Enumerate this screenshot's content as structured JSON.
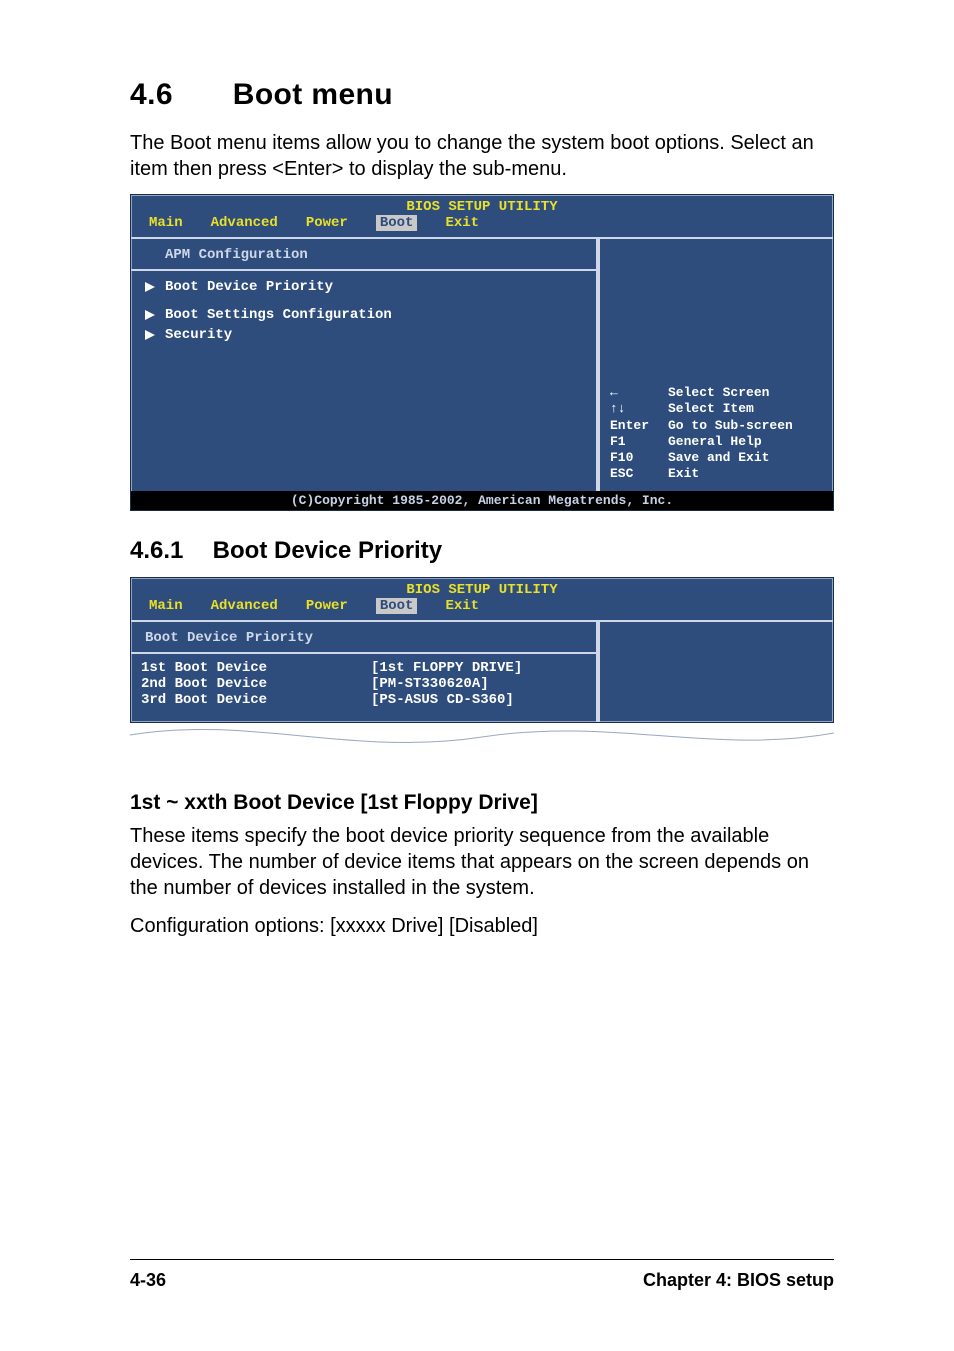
{
  "section": {
    "number": "4.6",
    "title": "Boot menu"
  },
  "intro": "The Boot menu items allow you to change the system boot options. Select an item then press <Enter> to display the sub-menu.",
  "bios1": {
    "title": "BIOS SETUP UTILITY",
    "tabs": [
      "Main",
      "Advanced",
      "Power",
      "Boot",
      "Exit"
    ],
    "selected_tab": "Boot",
    "header": "APM Configuration",
    "items": [
      "Boot Device Priority",
      "Boot Settings Configuration",
      "Security"
    ],
    "help": [
      {
        "key": "←",
        "label": "Select Screen"
      },
      {
        "key": "↑↓",
        "label": "Select Item"
      },
      {
        "key": "Enter",
        "label": "Go to Sub-screen"
      },
      {
        "key": "F1",
        "label": "General Help"
      },
      {
        "key": "F10",
        "label": "Save and Exit"
      },
      {
        "key": "ESC",
        "label": "Exit"
      }
    ],
    "copyright": "(C)Copyright 1985-2002, American Megatrends, Inc."
  },
  "sub": {
    "number": "4.6.1",
    "title": "Boot Device Priority"
  },
  "bios2": {
    "title": "BIOS SETUP UTILITY",
    "tabs": [
      "Main",
      "Advanced",
      "Power",
      "Boot",
      "Exit"
    ],
    "selected_tab": "Boot",
    "header": "Boot Device Priority",
    "rows": [
      {
        "key": "1st Boot Device",
        "val": "[1st FLOPPY DRIVE]"
      },
      {
        "key": "2nd Boot Device",
        "val": "[PM-ST330620A]"
      },
      {
        "key": "3rd Boot Device",
        "val": "[PS-ASUS CD-S360]"
      }
    ]
  },
  "subsub_title": "1st ~ xxth Boot Device [1st Floppy Drive]",
  "desc": "These items specify the boot device priority sequence from the available devices. The number of device items that appears on the screen depends on the number of devices installed in the system.",
  "config_line": "Configuration options: [xxxxx Drive] [Disabled]",
  "footer": {
    "page": "4-36",
    "chapter": "Chapter 4: BIOS setup"
  }
}
